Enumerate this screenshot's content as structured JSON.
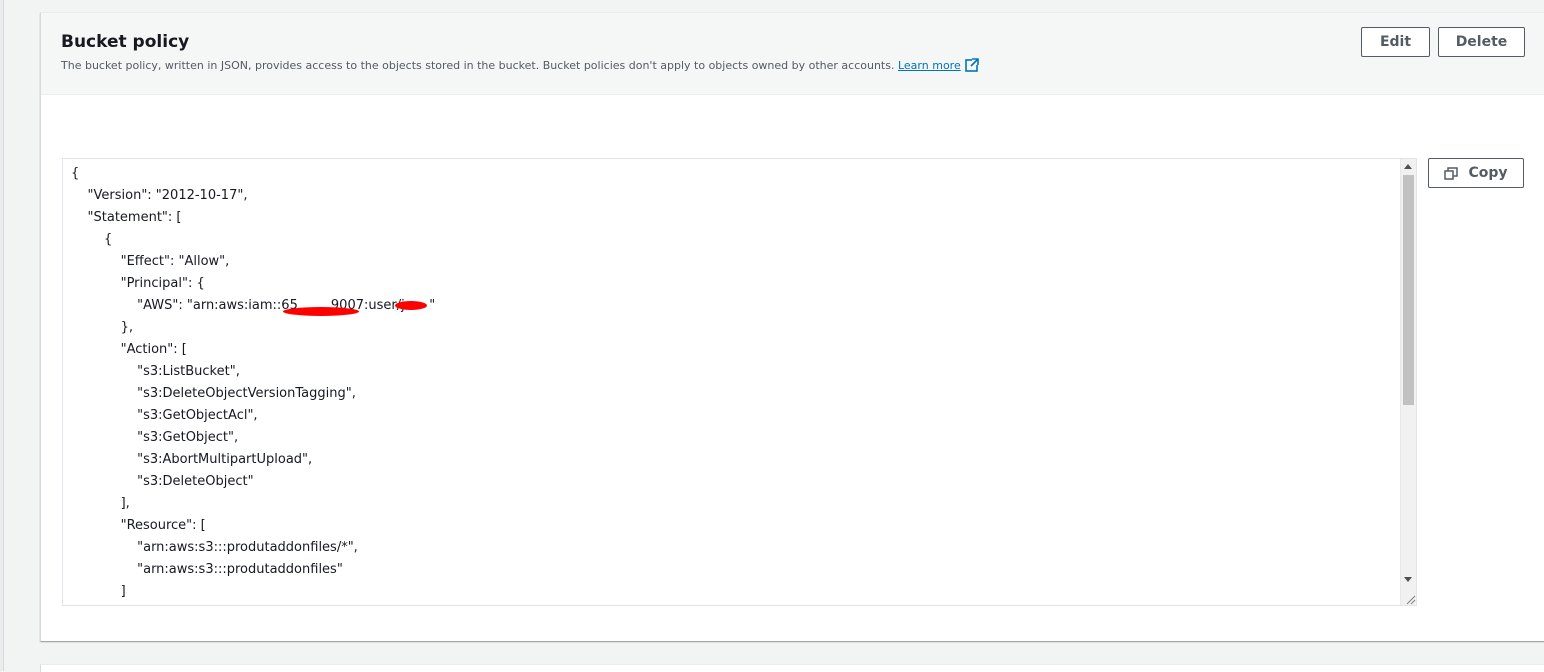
{
  "section": {
    "title": "Bucket policy",
    "description": "The bucket policy, written in JSON, provides access to the objects stored in the bucket. Bucket policies don't apply to objects owned by other accounts.",
    "learn_more": "Learn more"
  },
  "buttons": {
    "edit": "Edit",
    "delete": "Delete",
    "copy": "Copy"
  },
  "policy_lines": [
    "{",
    "    \"Version\": \"2012-10-17\",",
    "    \"Statement\": [",
    "        {",
    "            \"Effect\": \"Allow\",",
    "            \"Principal\": {",
    "                \"AWS\": \"arn:aws:iam::65        9007:user/ja    \"",
    "            },",
    "            \"Action\": [",
    "                \"s3:ListBucket\",",
    "                \"s3:DeleteObjectVersionTagging\",",
    "                \"s3:GetObjectAcl\",",
    "                \"s3:GetObject\",",
    "                \"s3:AbortMultipartUpload\",",
    "                \"s3:DeleteObject\"",
    "            ],",
    "            \"Resource\": [",
    "                \"arn:aws:s3:::produtaddonfiles/*\",",
    "                \"arn:aws:s3:::produtaddonfiles\"",
    "            ]"
  ],
  "icons": {
    "external_link": "external-link-icon",
    "copy": "copy-icon",
    "scroll_up": "scroll-up-arrow-icon",
    "scroll_down": "scroll-down-arrow-icon",
    "resize": "resize-grip-icon"
  },
  "colors": {
    "link": "#0073bb",
    "redaction": "#ff0000",
    "button_text": "#545b64"
  }
}
